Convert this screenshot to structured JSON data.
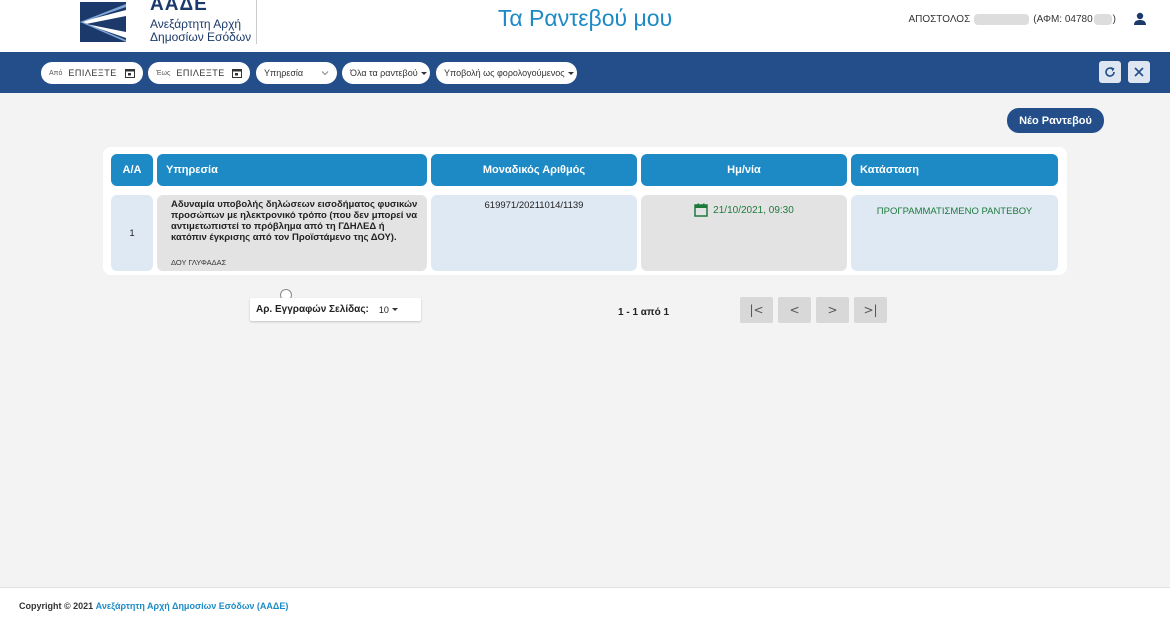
{
  "header": {
    "logo_abbr": "ΑΑΔΕ",
    "logo_line1": "Ανεξάρτητη Αρχή",
    "logo_line2": "Δημοσίων Εσόδων",
    "title": "Τα Ραντεβού μου",
    "user_name": "ΑΠΟΣΤΟΛΟΣ",
    "user_afm": "(ΑΦΜ: 04780",
    "user_afm_end": ")",
    "user_icon": "person-icon"
  },
  "toolbar": {
    "from_label": "Από",
    "from_value": "ΕΠΙΛΕΞΤΕ",
    "to_label": "Έως",
    "to_value": "ΕΠΙΛΕΞΤΕ",
    "service_placeholder": "Υπηρεσία",
    "status_filter": "Όλα τα ραντεβού",
    "submission_filter": "Υποβολή ως φορολογούμενος",
    "refresh_icon": "refresh-icon",
    "close_icon": "close-icon"
  },
  "main": {
    "new_button": "Νέο Ραντεβού"
  },
  "table": {
    "columns": [
      "Α/Α",
      "Υπηρεσία",
      "Μοναδικός Αριθμός",
      "Ημ/νία",
      "Κατάσταση"
    ],
    "rows": [
      {
        "index": "1",
        "service": "Αδυναμία υποβολής δηλώσεων εισοδήματος φυσικών προσώπων με ηλεκτρονικό τρόπο (που δεν μπορεί να αντιμετωπιστεί το πρόβλημα από τη ΓΔΗΛΕΔ ή κατόπιν έγκρισης από τον Προϊστάμενο της ΔΟΥ).",
        "office": "ΔΟΥ ΓΛΥΦΑΔΑΣ",
        "unique_number": "619971/20211014/1139",
        "date": "21/10/2021, 09:30",
        "status": "ΠΡΟΓΡΑΜΜΑΤΙΣΜΕΝΟ ΡΑΝΤΕΒΟΥ"
      }
    ]
  },
  "pagination": {
    "page_size_label": "Αρ. Εγγραφών Σελίδας:",
    "page_size": "10",
    "range": "1 - 1 από 1",
    "first": "|<",
    "prev": "<",
    "next": ">",
    "last": ">|"
  },
  "footer": {
    "copyright": "Copyright © 2021",
    "link": "Ανεξάρτητη Αρχή Δημοσίων Εσόδων (ΑΑΔΕ)"
  },
  "colors": {
    "brand_dark": "#234e8a",
    "accent": "#1d8ac6",
    "status_green": "#1e7a3c"
  }
}
